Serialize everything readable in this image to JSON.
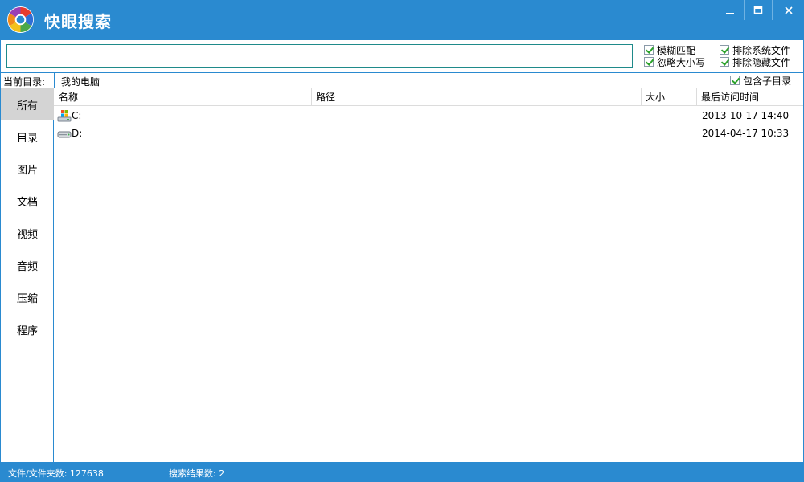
{
  "titlebar": {
    "title": "快眼搜索",
    "minimize": "–",
    "maximize": "□",
    "close": "✕"
  },
  "search": {
    "value": "",
    "placeholder": ""
  },
  "options": {
    "fuzzy": "模糊匹配",
    "ignore_case": "忽略大小写",
    "exclude_system": "排除系统文件",
    "exclude_hidden": "排除隐藏文件",
    "include_subdirs": "包含子目录"
  },
  "directory": {
    "label": "当前目录:",
    "value": "我的电脑"
  },
  "sidebar": {
    "items": [
      {
        "label": "所有"
      },
      {
        "label": "目录"
      },
      {
        "label": "图片"
      },
      {
        "label": "文档"
      },
      {
        "label": "视频"
      },
      {
        "label": "音频"
      },
      {
        "label": "压缩"
      },
      {
        "label": "程序"
      }
    ]
  },
  "table": {
    "columns": [
      "名称",
      "路径",
      "大小",
      "最后访问时间"
    ],
    "rows": [
      {
        "name": "C:",
        "path": "",
        "size": "",
        "accessed": "2013-10-17 14:40",
        "icon": "system-drive-icon"
      },
      {
        "name": "D:",
        "path": "",
        "size": "",
        "accessed": "2014-04-17 10:33",
        "icon": "hard-drive-icon"
      }
    ]
  },
  "status": {
    "files": "文件/文件夹数: 127638",
    "results": "搜索结果数: 2"
  },
  "colors": {
    "accent": "#2a8ad0",
    "check": "#2aa22a",
    "selected": "#d4d4d4"
  }
}
